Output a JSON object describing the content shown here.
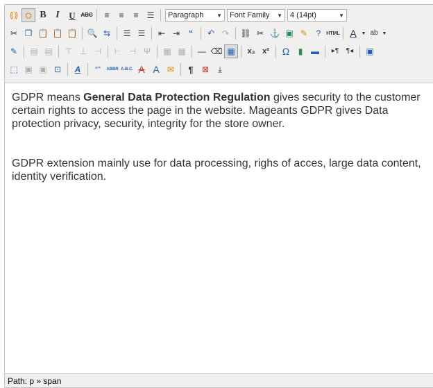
{
  "toolbar": {
    "format_select": "Paragraph",
    "font_family_select": "Font Family",
    "font_size_select": "4 (14pt)",
    "bold_glyph": "B",
    "italic_glyph": "I",
    "underline_glyph": "U",
    "strike_glyph": "ABC",
    "html_label": "HTML",
    "abbr_label": "ABBR",
    "acronym_label": "A.B.C.",
    "cite_label": "“”"
  },
  "content": {
    "para1_before": "GDPR means ",
    "para1_bold": "General Data Protection Regulation",
    "para1_after": " gives security to the customer certain rights to access the page in the website. Mageants GDPR gives Data protection privacy, security, integrity for the store owner.",
    "para2": "GDPR extension mainly use for data processing, righs of acces, large data content, identity verification."
  },
  "status": {
    "path": "Path: p » span"
  },
  "colors": {
    "toolbar_bg": "#f0f0ee",
    "border": "#c4c4c4",
    "text": "#333333"
  }
}
